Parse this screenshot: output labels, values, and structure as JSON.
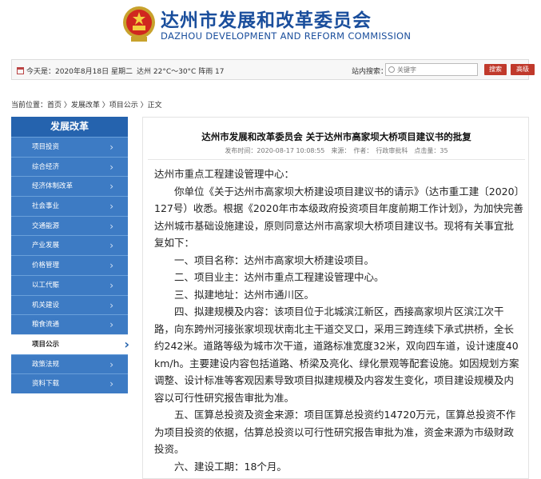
{
  "header": {
    "title_cn": "达州市发展和改革委员会",
    "title_en": "DAZHOU DEVELOPMENT AND REFORM COMMISSION"
  },
  "topbar": {
    "today": "今天是：2020年8月18日 星期二",
    "weather": "达州 22°C～30°C 阵雨 17",
    "search_label": "站内搜索：",
    "search_placeholder": "关键字",
    "search_button": "搜索",
    "advanced_button": "高级"
  },
  "breadcrumb": "当前位置：首页 〉发展改革 〉项目公示 〉正文",
  "sidebar": {
    "title": "发展改革",
    "items": [
      {
        "label": "项目投资",
        "active": false
      },
      {
        "label": "综合经济",
        "active": false
      },
      {
        "label": "经济体制改革",
        "active": false
      },
      {
        "label": "社会事业",
        "active": false
      },
      {
        "label": "交通能源",
        "active": false
      },
      {
        "label": "产业发展",
        "active": false
      },
      {
        "label": "价格管理",
        "active": false
      },
      {
        "label": "以工代赈",
        "active": false
      },
      {
        "label": "机关建设",
        "active": false
      },
      {
        "label": "粮食流通",
        "active": false
      },
      {
        "label": "项目公示",
        "active": true
      },
      {
        "label": "政策法规",
        "active": false
      },
      {
        "label": "资料下载",
        "active": false
      }
    ]
  },
  "article": {
    "title": "达州市发展和改革委员会 关于达州市高家坝大桥项目建议书的批复",
    "meta": "发布时间：2020-08-17 10:08:55　来源：　作者：　行政审批科　点击量：35",
    "addressee": "达州市重点工程建设管理中心：",
    "paragraphs": [
      "你单位《关于达州市高家坝大桥建设项目建议书的请示》（达市重工建〔2020〕127号）收悉。根据《2020年市本级政府投资项目年度前期工作计划》，为加快完善达州城市基础设施建设，原则同意达州市高家坝大桥项目建议书。现将有关事宜批复如下：",
      "一、项目名称：达州市高家坝大桥建设项目。",
      "二、项目业主：达州市重点工程建设管理中心。",
      "三、拟建地址：达州市通川区。",
      "四、拟建规模及内容：该项目位于北城滨江新区，西接高家坝片区滨江次干路，向东跨州河接张家坝现状南北主干道交叉口，采用三跨连续下承式拱桥，全长约242米。道路等级为城市次干道，道路标准宽度32米，双向四车道，设计速度40 km/h。主要建设内容包括道路、桥梁及亮化、绿化景观等配套设施。如因规划方案调整、设计标准等客观因素导致项目拟建规模及内容发生变化，项目建设规模及内容以可行性研究报告审批为准。",
      "五、匡算总投资及资金来源：项目匡算总投资约14720万元，匡算总投资不作为项目投资的依据，估算总投资以可行性研究报告审批为准，资金来源为市级财政投资。",
      "六、建设工期：18个月。"
    ]
  }
}
